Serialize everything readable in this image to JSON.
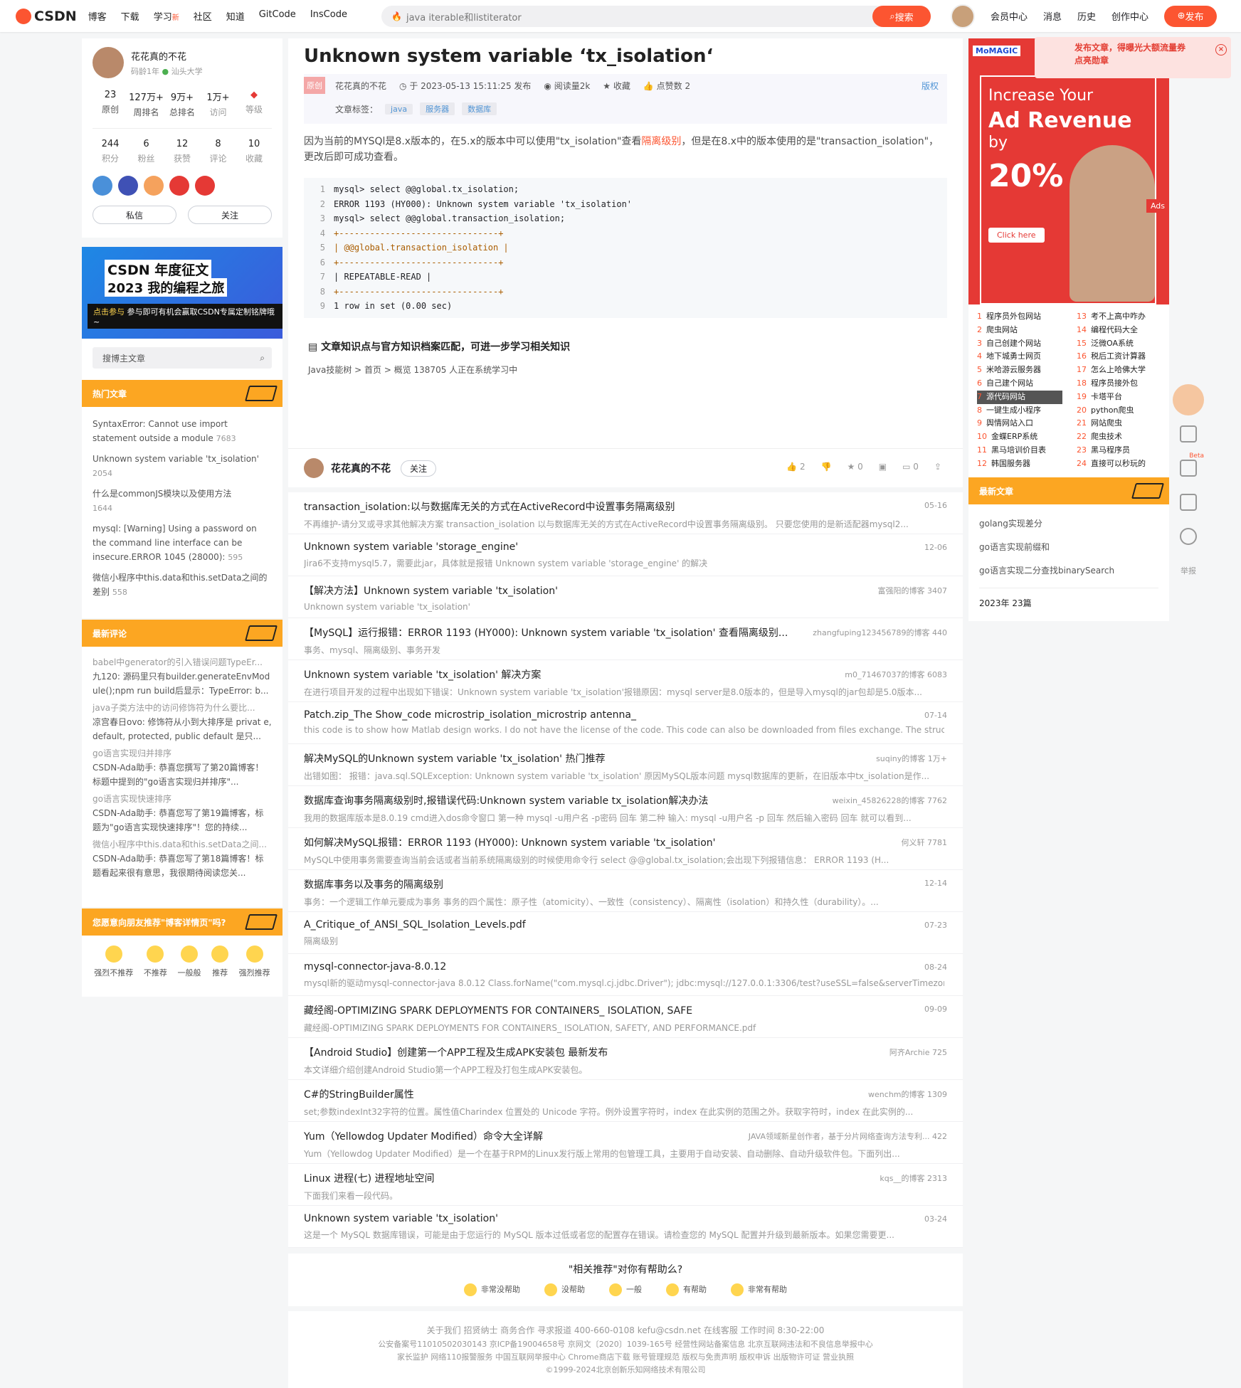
{
  "header": {
    "logo": "CSDN",
    "nav": [
      "博客",
      "下载",
      "学习",
      "社区",
      "知道",
      "GitCode",
      "InsCode"
    ],
    "nav_new": "新",
    "search_placeholder": "java iterable和listiterator",
    "search_button": "搜索",
    "right": [
      "会员中心",
      "消息",
      "历史",
      "创作中心"
    ],
    "publish": "发布"
  },
  "profile": {
    "name": "花花真的不花",
    "age": "码龄1年",
    "school": "汕头大学",
    "stats1": [
      {
        "n": "23",
        "l": "原创"
      },
      {
        "n": "127万+",
        "l": "周排名"
      },
      {
        "n": "9万+",
        "l": "总排名"
      },
      {
        "n": "1万+",
        "l": "访问"
      },
      {
        "n": "",
        "l": "等级"
      }
    ],
    "stats2": [
      {
        "n": "244",
        "l": "积分"
      },
      {
        "n": "6",
        "l": "粉丝"
      },
      {
        "n": "12",
        "l": "获赞"
      },
      {
        "n": "8",
        "l": "评论"
      },
      {
        "n": "10",
        "l": "收藏"
      }
    ],
    "btn_msg": "私信",
    "btn_follow": "关注"
  },
  "left_ad": {
    "t1": "CSDN 年度征文",
    "t2": "2023 我的编程之旅",
    "t3": "参与即可有机会赢取CSDN专属定制铭牌哦~",
    "tag": "点击参与"
  },
  "left_search": "搜博主文章",
  "hot": {
    "title": "热门文章",
    "items": [
      {
        "t": "SyntaxError: Cannot use import statement outside a module",
        "c": "7683"
      },
      {
        "t": "Unknown system variable 'tx_isolation'",
        "c": "2054"
      },
      {
        "t": "什么是commonJS模块以及使用方法",
        "c": "1644"
      },
      {
        "t": "mysql: [Warning] Using a password on the command line interface can be insecure.ERROR 1045 (28000):",
        "c": "595"
      },
      {
        "t": "微信小程序中this.data和this.setData之间的差别",
        "c": "558"
      }
    ]
  },
  "comments": {
    "title": "最新评论",
    "items": [
      {
        "q": "babel中generator的引入错误问题TypeEr...",
        "a": "九120: 源码里只有builder.generateEnvMod ule();npm run build后显示：TypeError: b..."
      },
      {
        "q": "java子类方法中的访问修饰符为什么要比...",
        "a": "凉宫春日ovo: 修饰符从小到大排序是 privat e, default, protected, public default 是只..."
      },
      {
        "q": "go语言实现归并排序",
        "a": "CSDN-Ada助手: 恭喜您撰写了第20篇博客！标题中提到的\"go语言实现归并排序\"..."
      },
      {
        "q": "go语言实现快速排序",
        "a": "CSDN-Ada助手: 恭喜您写了第19篇博客，标题为\"go语言实现快速排序\"！您的持续..."
      },
      {
        "q": "微信小程序中this.data和this.setData之间...",
        "a": "CSDN-Ada助手: 恭喜您写了第18篇博客！标题看起来很有意思，我很期待阅读您关..."
      }
    ]
  },
  "rate_left": {
    "title": "您愿意向朋友推荐\"博客详情页\"吗?",
    "opts": [
      "强烈不推荐",
      "不推荐",
      "一般般",
      "推荐",
      "强烈推荐"
    ]
  },
  "article": {
    "title": "Unknown system variable ‘tx_isolation‘",
    "badge": "原创",
    "author": "花花真的不花",
    "date": "于 2023-05-13 15:11:25 发布",
    "reads": "阅读量2k",
    "fav": "收藏",
    "likes": "点赞数 2",
    "copyright": "版权",
    "tag_label": "文章标签：",
    "tags": [
      "java",
      "服务器",
      "数据库"
    ],
    "para1": "因为当前的MYSQl是8.x版本的，在5.x的版本中可以使用\"tx_isolation\"查看",
    "para_link": "隔离级别",
    "para2": "，但是在8.x中的版本使用的是\"transaction_isolation\"，更改后即可成功查看。",
    "code": [
      "mysql> select @@global.tx_isolation;",
      "ERROR 1193 (HY000): Unknown system variable 'tx_isolation'",
      "mysql> select @@global.transaction_isolation;",
      "+-------------------------------+",
      "| @@global.transaction_isolation |",
      "+-------------------------------+",
      "| REPEATABLE-READ               |",
      "+-------------------------------+",
      "1 row in set (0.00 sec)"
    ],
    "know_title": "文章知识点与官方知识档案匹配，可进一步学习相关知识",
    "know_sub": "Java技能树 > 首页 > 概览    138705 人正在系统学习中"
  },
  "authorbar": {
    "name": "花花真的不花",
    "follow": "关注",
    "likes": "2",
    "star": "0",
    "comment": "0"
  },
  "recs": [
    {
      "t": "transaction_isolation:以与数据库无关的方式在ActiveRecord中设置事务隔离级别",
      "d": "不再维护-请分叉或寻求其他解决方案 transaction_isolation 以与数据库无关的方式在ActiveRecord中设置事务隔离级别。 只要您使用的是新适配器mysql2...",
      "r": "05-16"
    },
    {
      "t": "Unknown system variable 'storage_engine'",
      "d": "Jira6不支持mysql5.7，需要此jar，具体就是报错 Unknown system variable 'storage_engine' 的解决",
      "r": "12-06"
    },
    {
      "t": "【解决方法】Unknown system variable 'tx_isolation'",
      "d": "Unknown system variable 'tx_isolation'",
      "r": "富强阳的博客   3407"
    },
    {
      "t": "【MySQL】运行报错：ERROR 1193 (HY000): Unknown system variable 'tx_isolation' 查看隔离级别...",
      "d": "事务、mysql、隔离级别、事务开发",
      "r": "zhangfuping123456789的博客   440"
    },
    {
      "t": "Unknown system variable 'tx_isolation' 解决方案",
      "d": "在进行项目开发的过程中出现如下错误：Unknown system variable 'tx_isolation'报错原因：mysql server是8.0版本的，但是导入mysql的jar包却是5.0版本...",
      "r": "m0_71467037的博客   6083"
    },
    {
      "t": "Patch.zip_The Show_code microstrip_isolation_microstrip antenna_",
      "d": "this code is to show how Matlab design works. I do not have the license of the code. This code can also be downloaded from files exchange. The structur...",
      "r": "07-14"
    },
    {
      "t": "解决MySQL的Unknown system variable 'tx_isolation'  热门推荐",
      "d": "出错如图： 报错：java.sql.SQLException: Unknown system variable 'tx_isolation' 原因MySQL版本问题 mysql数据库的更新，在旧版本中tx_isolation是作...",
      "r": "suqiny的博客   1万+"
    },
    {
      "t": "数据库查询事务隔离级别时,报错误代码:Unknown system variable tx_isolation解决办法",
      "d": "我用的数据库版本是8.0.19 cmd进入dos命令窗口 第一种 mysql -u用户名 -p密码 回车 第二种 输入: mysql -u用户名 -p 回车 然后输入密码 回车 就可以看到...",
      "r": "weixin_45826228的博客   7762"
    },
    {
      "t": "如何解决MySQL报错：ERROR 1193 (HY000): Unknown system variable 'tx_isolation'",
      "d": "MySQL中使用事务需要查询当前会话或者当前系统隔离级别的时候使用命令行 select @@global.tx_isolation;会出现下列报错信息： ERROR 1193 (H...",
      "r": "何义轩   7781"
    },
    {
      "t": "数据库事务以及事务的隔离级别",
      "d": "事务：一个逻辑工作单元要成为事务    事务的四个属性：原子性（atomicity）、一致性（consistency）、隔离性（isolation）和持久性（durability）。...",
      "r": "12-14"
    },
    {
      "t": "A_Critique_of_ANSI_SQL_Isolation_Levels.pdf",
      "d": "隔离级别",
      "r": "07-23"
    },
    {
      "t": "mysql-connector-java-8.0.12",
      "d": "mysql新的驱动mysql-connector-java 8.0.12 Class.forName(\"com.mysql.cj.jdbc.Driver\"); jdbc:mysql://127.0.0.1:3306/test?useSSL=false&serverTimezone...",
      "r": "08-24"
    },
    {
      "t": "藏经阁-OPTIMIZING SPARK DEPLOYMENTS FOR CONTAINERS_ ISOLATION, SAFE",
      "d": "藏经阁-OPTIMIZING SPARK DEPLOYMENTS FOR CONTAINERS_ ISOLATION, SAFETY, AND PERFORMANCE.pdf",
      "r": "09-09"
    },
    {
      "t": "【Android Studio】创建第一个APP工程及生成APK安装包  最新发布",
      "d": "本文详细介绍创建Android Studio第一个APP工程及打包生成APK安装包。",
      "r": "阿齐Archie   725"
    },
    {
      "t": "C#的StringBuilder属性",
      "d": "set;参数indexInt32字符的位置。属性值Charindex 位置处的 Unicode 字符。例外设置字符时，index 在此实例的范围之外。获取字符时，index 在此实例的...",
      "r": "wenchm的博客   1309"
    },
    {
      "t": "Yum（Yellowdog Updater Modified）命令大全详解",
      "d": "Yum（Yellowdog Updater Modified）是一个在基于RPM的Linux发行版上常用的包管理工具，主要用于自动安装、自动删除、自动升级软件包。下面列出...",
      "r": "JAVA领域新星创作者，基于分片网络查询方法专利...   422"
    },
    {
      "t": "Linux 进程(七) 进程地址空间",
      "d": "下面我们来看一段代码。",
      "r": "kqs__的博客   2313"
    },
    {
      "t": "Unknown system variable 'tx_isolation'",
      "d": "这是一个 MySQL 数据库错误，可能是由于您运行的 MySQL 版本过低或者您的配置存在错误。请检查您的 MySQL 配置并升级到最新版本。如果您需要更...",
      "r": "03-24"
    }
  ],
  "helpful": {
    "q": "\"相关推荐\"对你有帮助么?",
    "opts": [
      "非常没帮助",
      "没帮助",
      "一般",
      "有帮助",
      "非常有帮助"
    ]
  },
  "footer": {
    "l1": "关于我们  招贤纳士  商务合作  寻求报道  400-660-0108  kefu@csdn.net  在线客服  工作时间 8:30-22:00",
    "l2": "公安备案号11010502030143  京ICP备19004658号  京网文〔2020〕1039-165号  经营性网站备案信息  北京互联网违法和不良信息举报中心",
    "l3": "家长监护  网络110报警服务  中国互联网举报中心  Chrome商店下载  账号管理规范  版权与免责声明  版权申诉  出版物许可证  营业执照",
    "l4": "©1999-2024北京创新乐知网络技术有限公司"
  },
  "right_ad": {
    "brand": "MoMAGIC",
    "l1": "Increase Your",
    "l2": "Ad Revenue",
    "l3": "by",
    "l4": "20%",
    "click": "Click here",
    "ads": "Ads"
  },
  "promo": {
    "text": "发布文章，得曝光大额流量券",
    "text2": "点亮勋章"
  },
  "ranks": {
    "left": [
      [
        "1",
        "程序员外包网站"
      ],
      [
        "2",
        "爬虫网站"
      ],
      [
        "3",
        "自己创建个网站"
      ],
      [
        "4",
        "地下城勇士网页"
      ],
      [
        "5",
        "米哈游云服务器"
      ],
      [
        "6",
        "自己建个网站"
      ],
      [
        "7",
        "源代码网站"
      ],
      [
        "8",
        "一键生成小程序"
      ],
      [
        "9",
        "舆情网站入口"
      ],
      [
        "10",
        "金蝶ERP系统"
      ],
      [
        "11",
        "黑马培训价目表"
      ],
      [
        "12",
        "韩国服务器"
      ]
    ],
    "right": [
      [
        "13",
        "考不上高中咋办"
      ],
      [
        "14",
        "编程代码大全"
      ],
      [
        "15",
        "泛微OA系统"
      ],
      [
        "16",
        "税后工资计算器"
      ],
      [
        "17",
        "怎么上哈佛大学"
      ],
      [
        "18",
        "程序员接外包"
      ],
      [
        "19",
        "卡塔平台"
      ],
      [
        "20",
        "python爬虫"
      ],
      [
        "21",
        "网站爬虫"
      ],
      [
        "22",
        "爬虫技术"
      ],
      [
        "23",
        "黑马程序员"
      ],
      [
        "24",
        "直接可以秒玩的"
      ]
    ]
  },
  "newarts": {
    "title": "最新文章",
    "items": [
      "golang实现差分",
      "go语言实现前缀和",
      "go语言实现二分查找binarySearch"
    ],
    "year": "2023年  23篇"
  },
  "sidetools": {
    "beta": "Beta",
    "report": "举报"
  }
}
